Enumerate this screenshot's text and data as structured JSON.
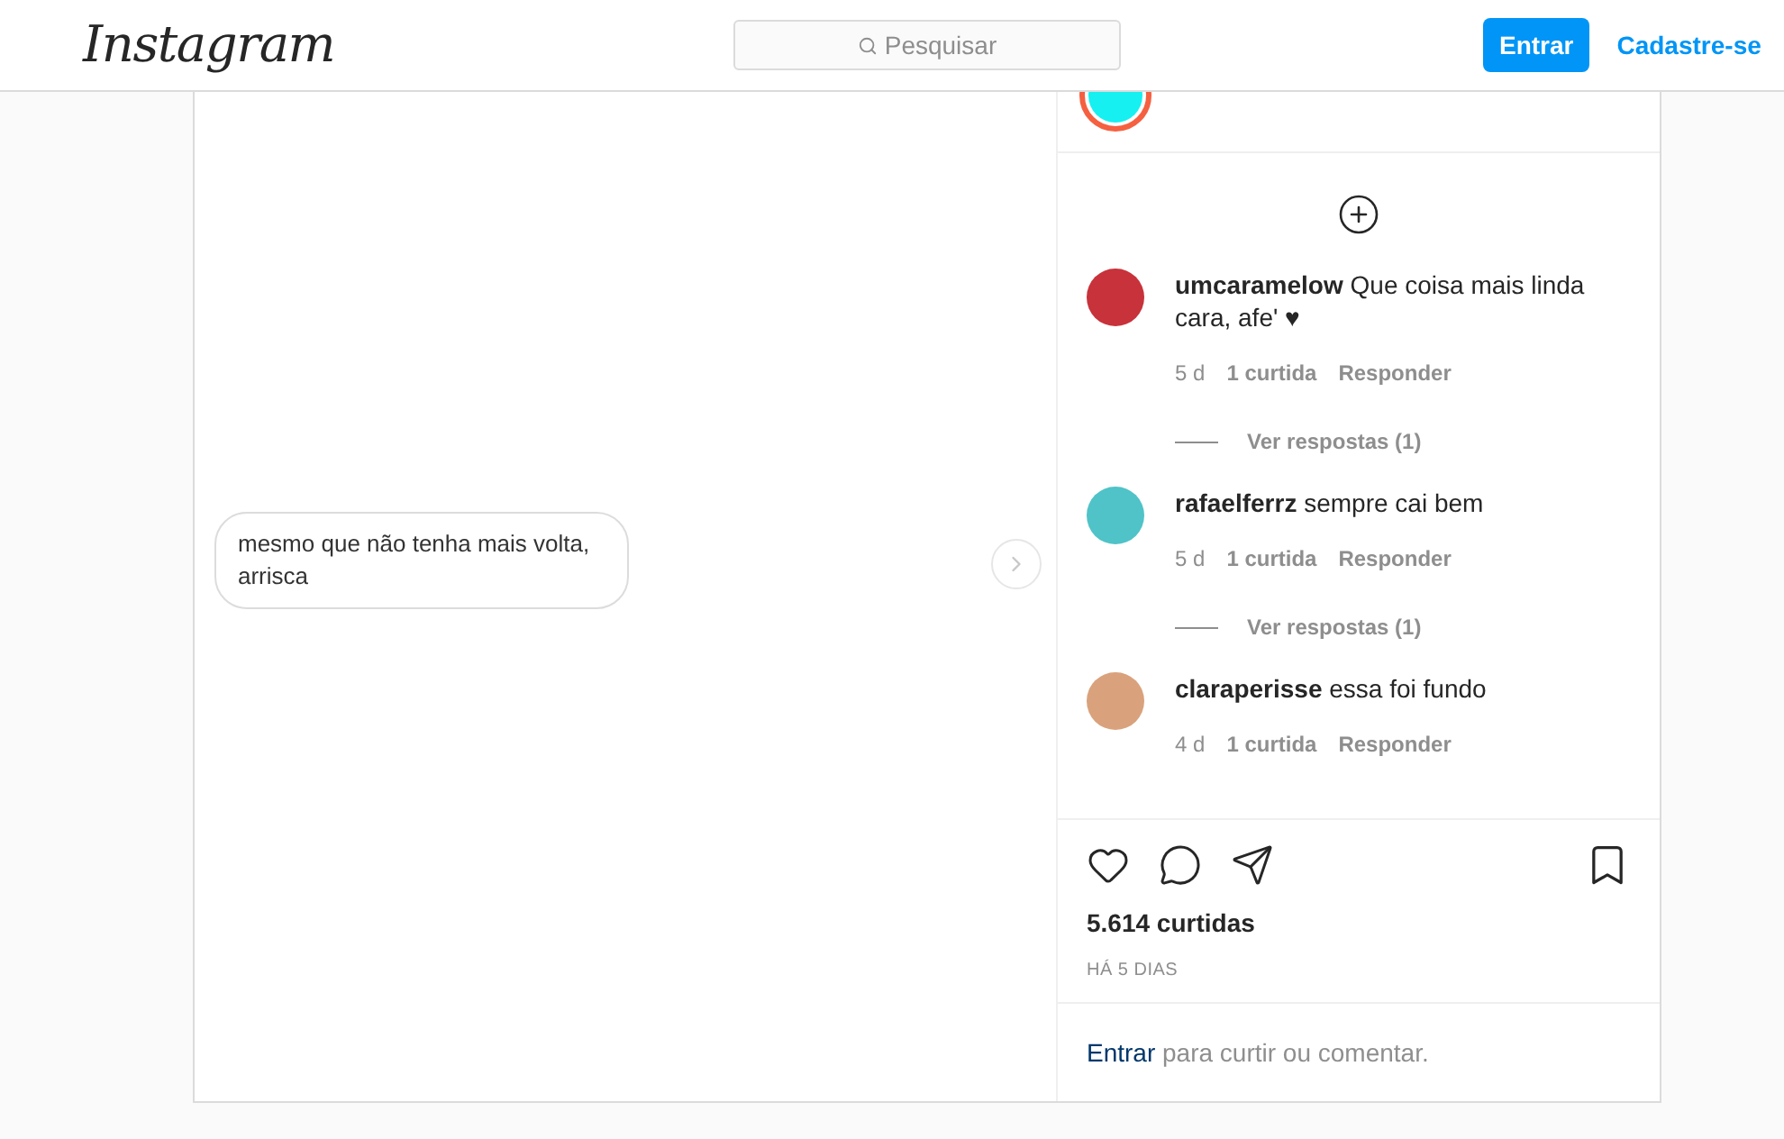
{
  "header": {
    "logo": "Instagram",
    "search": {
      "placeholder": "Pesquisar"
    },
    "login_button": "Entrar",
    "signup_link": "Cadastre-se"
  },
  "post": {
    "image": {
      "bubble_text": "mesmo que não tenha mais volta,\narrisca"
    },
    "comments": [
      {
        "user": "umcaramelow",
        "text": "Que coisa mais linda cara, afe' ♥",
        "age": "5 d",
        "likes": "1 curtida",
        "reply": "Responder",
        "replies_link": "Ver respostas (1)",
        "color": "#c8323a"
      },
      {
        "user": "rafaelferrz",
        "text": "sempre cai bem",
        "age": "5 d",
        "likes": "1 curtida",
        "reply": "Responder",
        "replies_link": "Ver respostas (1)",
        "color": "#4fc3c8"
      },
      {
        "user": "claraperisse",
        "text": "essa foi fundo",
        "age": "4 d",
        "likes": "1 curtida",
        "reply": "Responder",
        "color": "#d9a27c"
      }
    ],
    "likes": "5.614 curtidas",
    "date": "HÁ 5 DIAS",
    "login_prompt": {
      "link": "Entrar",
      "text": "para curtir ou comentar."
    }
  }
}
